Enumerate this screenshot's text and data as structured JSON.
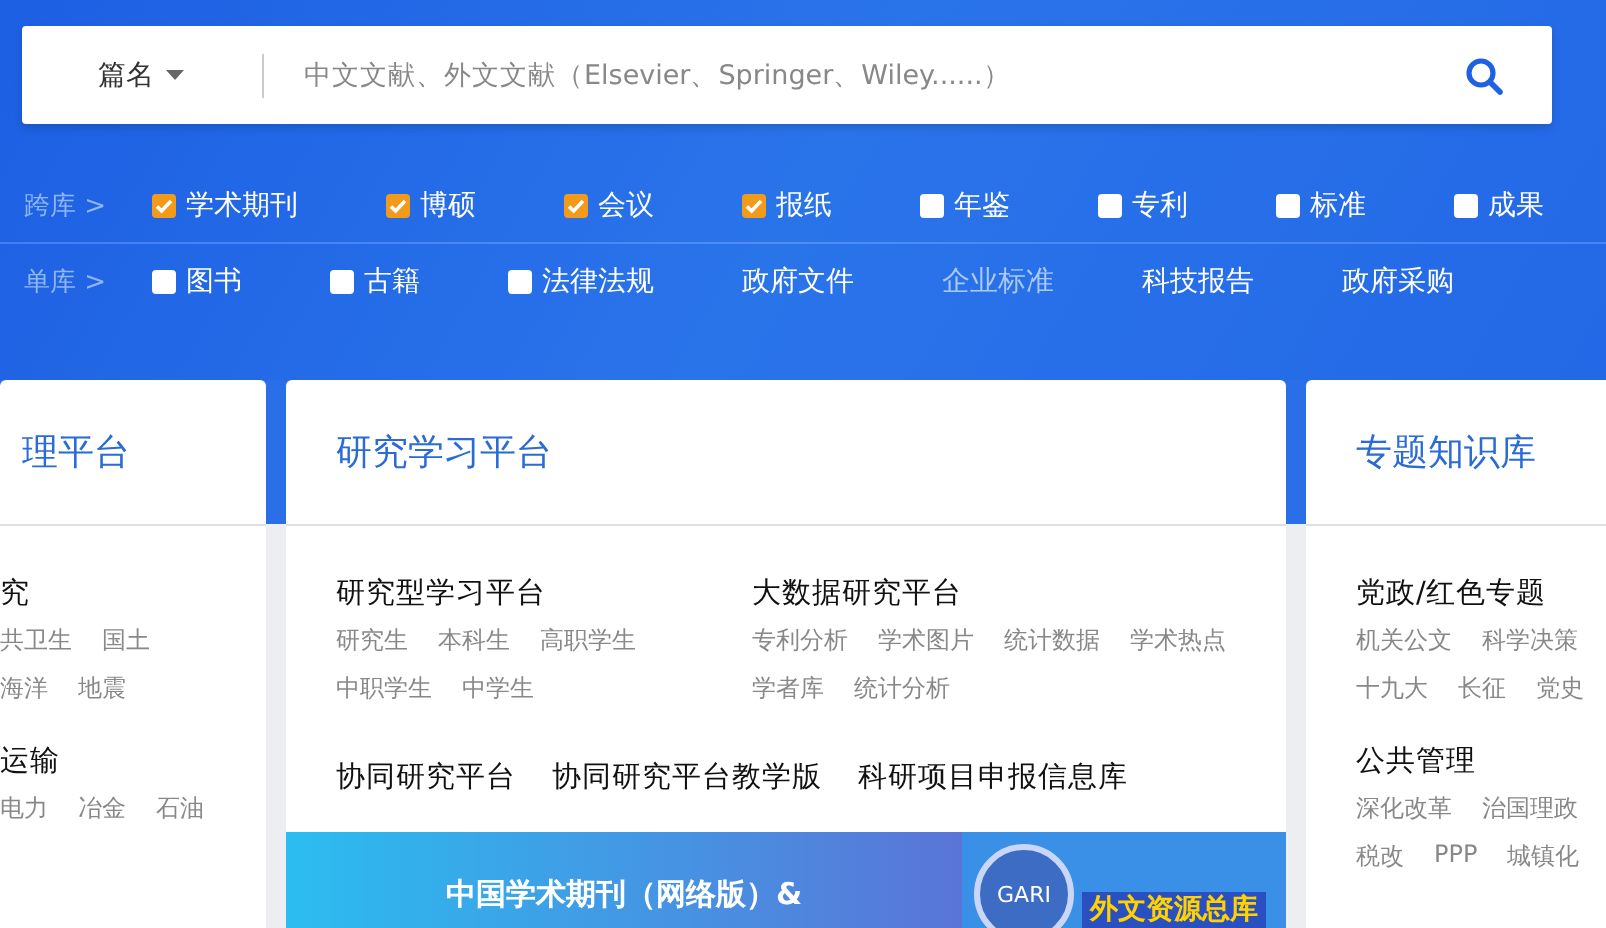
{
  "search": {
    "field_select": "篇名",
    "placeholder": "中文文献、外文文献（Elsevier、Springer、Wiley......）"
  },
  "filter_rows": [
    {
      "label": "跨库 >",
      "items": [
        {
          "kind": "checkbox",
          "label": "学术期刊",
          "checked": true
        },
        {
          "kind": "checkbox",
          "label": "博硕",
          "checked": true
        },
        {
          "kind": "checkbox",
          "label": "会议",
          "checked": true
        },
        {
          "kind": "checkbox",
          "label": "报纸",
          "checked": true
        },
        {
          "kind": "checkbox",
          "label": "年鉴",
          "checked": false
        },
        {
          "kind": "checkbox",
          "label": "专利",
          "checked": false
        },
        {
          "kind": "checkbox",
          "label": "标准",
          "checked": false
        },
        {
          "kind": "checkbox",
          "label": "成果",
          "checked": false
        }
      ]
    },
    {
      "label": "单库 >",
      "items": [
        {
          "kind": "checkbox",
          "label": "图书",
          "checked": false
        },
        {
          "kind": "checkbox",
          "label": "古籍",
          "checked": false
        },
        {
          "kind": "checkbox",
          "label": "法律法规",
          "checked": false
        },
        {
          "kind": "link",
          "label": "政府文件",
          "muted": false
        },
        {
          "kind": "link",
          "label": "企业标准",
          "muted": true
        },
        {
          "kind": "link",
          "label": "科技报告",
          "muted": false
        },
        {
          "kind": "link",
          "label": "政府采购",
          "muted": false
        }
      ]
    }
  ],
  "cards": [
    {
      "title": "理平台",
      "sections": [
        {
          "title": "究",
          "items": [
            "共卫生",
            "国土",
            "海洋",
            "地震"
          ]
        },
        {
          "title": "运输",
          "items": [
            "电力",
            "冶金",
            "石油"
          ]
        }
      ]
    },
    {
      "title": "研究学习平台",
      "columns": [
        {
          "title": "研究型学习平台",
          "items": [
            "研究生",
            "本科生",
            "高职学生",
            "中职学生",
            "中学生"
          ]
        },
        {
          "title": "大数据研究平台",
          "items": [
            "专利分析",
            "学术图片",
            "统计数据",
            "学术热点",
            "学者库",
            "统计分析"
          ]
        }
      ],
      "links": [
        "协同研究平台",
        "协同研究平台教学版",
        "科研项目申报信息库"
      ],
      "banner": {
        "left_text": "中国学术期刊（网络版）&",
        "badge": "GARI",
        "right_text": "外文资源总库"
      }
    },
    {
      "title": "专题知识库",
      "sections": [
        {
          "title": "党政/红色专题",
          "items": [
            "机关公文",
            "科学决策",
            "十九大",
            "长征",
            "党史"
          ]
        },
        {
          "title": "公共管理",
          "items": [
            "深化改革",
            "治国理政",
            "税改",
            "PPP",
            "城镇化"
          ]
        }
      ]
    }
  ]
}
